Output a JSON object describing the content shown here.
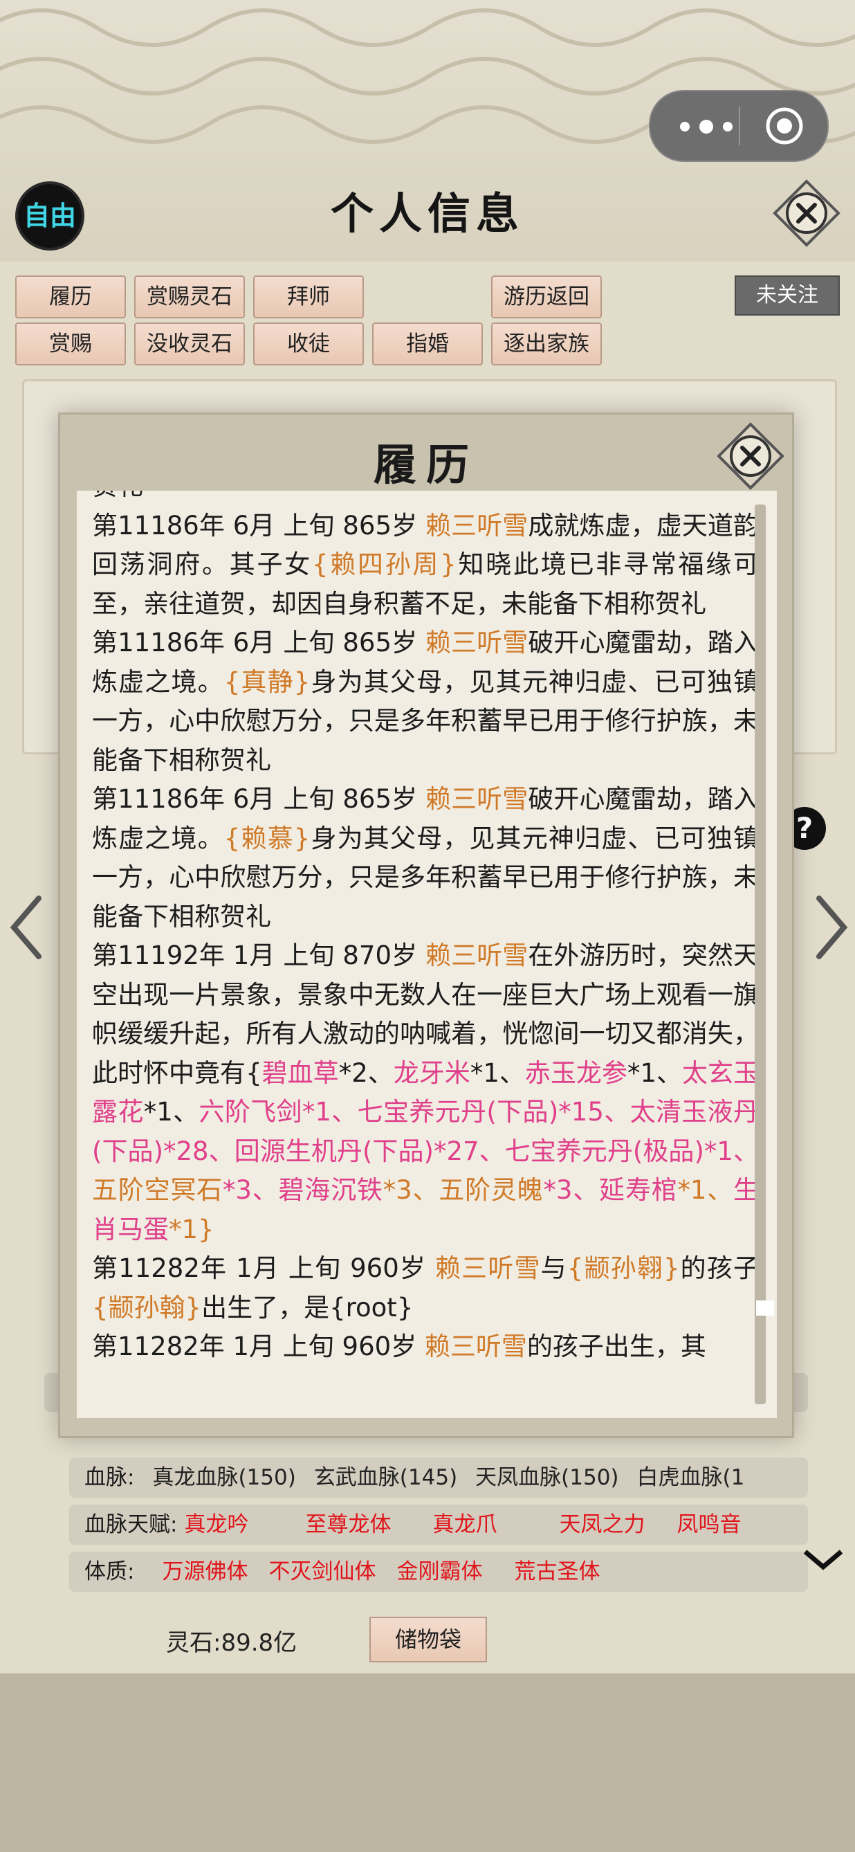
{
  "header": {
    "title": "个人信息",
    "free_badge": "自由",
    "close_icon": "close-icon",
    "menu_icon": "more-dots-icon",
    "miniapp_close_icon": "target-icon"
  },
  "action_buttons": [
    {
      "label": "履历"
    },
    {
      "label": "赏赐灵石"
    },
    {
      "label": "拜师"
    },
    {
      "label": "游历返回"
    },
    {
      "label": "赏赐"
    },
    {
      "label": "没收灵石"
    },
    {
      "label": "收徒"
    },
    {
      "label": "指婚"
    },
    {
      "label": "逐出家族"
    }
  ],
  "follow_tag": "未关注",
  "attributes": {
    "bloodline_label": "血脉:",
    "bloodlines": [
      "真龙血脉(150)",
      "玄武血脉(145)",
      "天凤血脉(150)",
      "白虎血脉(1"
    ],
    "talent_label": "血脉天赋:",
    "talents": [
      "真龙吟",
      "至尊龙体",
      "真龙爪",
      "天凤之力",
      "凤鸣音"
    ],
    "physique_label": "体质:",
    "physiques": [
      "万源佛体",
      "不灭剑仙体",
      "金刚霸体",
      "荒古圣体"
    ]
  },
  "footer": {
    "spirit_stone": "灵石:89.8亿",
    "bag_button": "储物袋"
  },
  "modal": {
    "title": "履历",
    "entries": [
      {
        "segments": [
          {
            "t": "贺礼",
            "c": ""
          }
        ]
      },
      {
        "segments": [
          {
            "t": "第11186年 6月 上旬  865岁 ",
            "c": ""
          },
          {
            "t": "赖三听雪",
            "c": "nm"
          },
          {
            "t": "成就炼虚，虚天道韵回荡洞府。其子女",
            "c": ""
          },
          {
            "t": "{赖四孙周}",
            "c": "nm"
          },
          {
            "t": "知晓此境已非寻常福缘可至，亲往道贺，却因自身积蓄不足，未能备下相称贺礼",
            "c": ""
          }
        ]
      },
      {
        "segments": [
          {
            "t": "第11186年 6月 上旬  865岁 ",
            "c": ""
          },
          {
            "t": "赖三听雪",
            "c": "nm"
          },
          {
            "t": "破开心魔雷劫，踏入炼虚之境。",
            "c": ""
          },
          {
            "t": "{真静}",
            "c": "nm"
          },
          {
            "t": "身为其父母，见其元神归虚、已可独镇一方，心中欣慰万分，只是多年积蓄早已用于修行护族，未能备下相称贺礼",
            "c": ""
          }
        ]
      },
      {
        "segments": [
          {
            "t": "第11186年 6月 上旬  865岁 ",
            "c": ""
          },
          {
            "t": "赖三听雪",
            "c": "nm"
          },
          {
            "t": "破开心魔雷劫，踏入炼虚之境。",
            "c": ""
          },
          {
            "t": "{赖慕}",
            "c": "nm"
          },
          {
            "t": "身为其父母，见其元神归虚、已可独镇一方，心中欣慰万分，只是多年积蓄早已用于修行护族，未能备下相称贺礼",
            "c": ""
          }
        ]
      },
      {
        "segments": [
          {
            "t": "第11192年 1月 上旬  870岁 ",
            "c": ""
          },
          {
            "t": "赖三听雪",
            "c": "nm"
          },
          {
            "t": "在外游历时，突然天空出现一片景象，景象中无数人在一座巨大广场上观看一旗帜缓缓升起，所有人激动的呐喊着，恍惚间一切又都消失，此时怀中竟有{",
            "c": ""
          },
          {
            "t": "碧血草",
            "c": "it"
          },
          {
            "t": "*2、",
            "c": ""
          },
          {
            "t": "龙牙米",
            "c": "it"
          },
          {
            "t": "*1、",
            "c": ""
          },
          {
            "t": "赤玉龙参",
            "c": "it"
          },
          {
            "t": "*1、",
            "c": ""
          },
          {
            "t": "太玄玉露花",
            "c": "it"
          },
          {
            "t": "*1、",
            "c": ""
          },
          {
            "t": "六阶飞剑*1、七宝养元丹(下品)*15、太清玉液丹(下品)*28、回源生机丹(下品)*27、七宝养元丹(极品)*1、",
            "c": "it"
          },
          {
            "t": "五阶空冥石",
            "c": "org"
          },
          {
            "t": "*3、碧海沉铁",
            "c": "it"
          },
          {
            "t": "*3、五阶灵魄",
            "c": "org"
          },
          {
            "t": "*3、延寿棺",
            "c": "it"
          },
          {
            "t": "*1、",
            "c": "org"
          },
          {
            "t": "生肖马蛋",
            "c": "it"
          },
          {
            "t": "*1}",
            "c": "org"
          }
        ]
      },
      {
        "segments": [
          {
            "t": "第11282年 1月 上旬  960岁 ",
            "c": ""
          },
          {
            "t": "赖三听雪",
            "c": "nm"
          },
          {
            "t": "与",
            "c": ""
          },
          {
            "t": "{颛孙翱}",
            "c": "nm"
          },
          {
            "t": "的孩子",
            "c": ""
          },
          {
            "t": "{颛孙翰}",
            "c": "nm"
          },
          {
            "t": "出生了，是{root}",
            "c": ""
          }
        ]
      },
      {
        "segments": [
          {
            "t": "第11282年 1月 上旬  960岁 ",
            "c": ""
          },
          {
            "t": "赖三听雪",
            "c": "nm"
          },
          {
            "t": "的孩子出生，其",
            "c": ""
          }
        ]
      }
    ]
  }
}
